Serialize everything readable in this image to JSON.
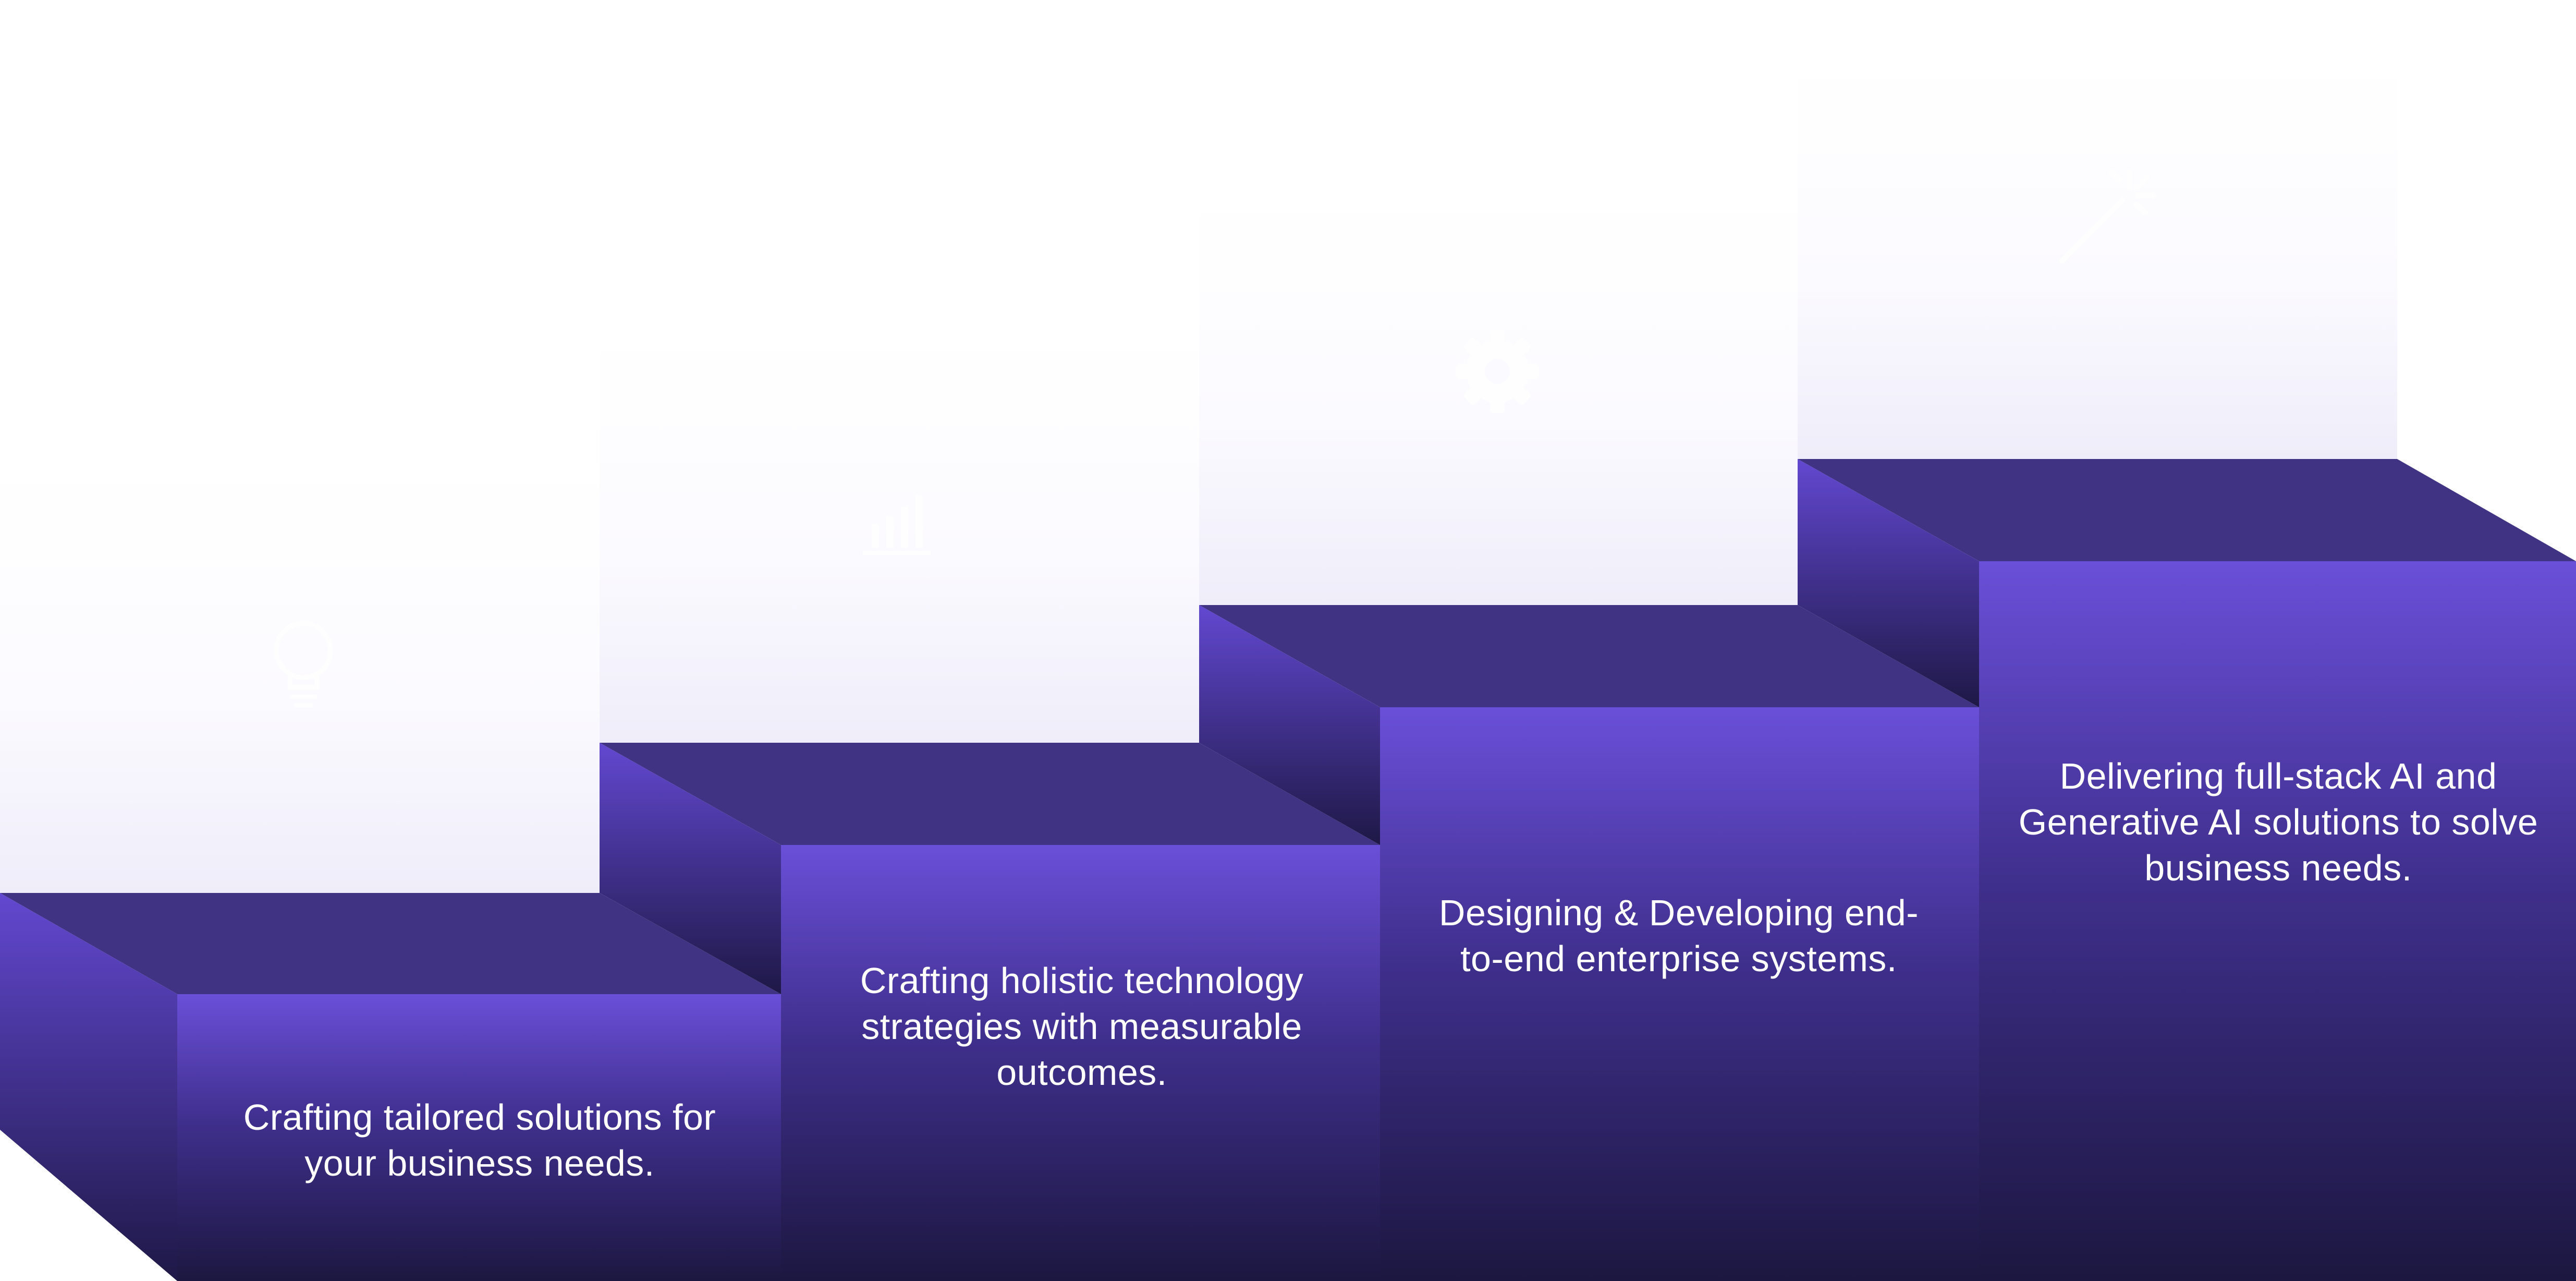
{
  "steps": [
    {
      "icon": "lightbulb-icon",
      "text": "Crafting tailored solutions for your business needs."
    },
    {
      "icon": "bar-chart-icon",
      "text": "Crafting holistic technology strategies with measurable outcomes."
    },
    {
      "icon": "gear-icon",
      "text": "Designing & Developing end-to-end enterprise systems."
    },
    {
      "icon": "magic-wand-icon",
      "text": "Delivering full-stack AI and Generative AI solutions to solve business needs."
    }
  ],
  "colors": {
    "front_top": "#6a4fd8",
    "front_bottom": "#1c1740",
    "top_face": "#413384",
    "side_top": "#5f47c9",
    "side_bottom": "#1e1846",
    "panel_top": "#ffffff",
    "panel_bottom": "#efedf9",
    "icon": "#ffffff"
  }
}
